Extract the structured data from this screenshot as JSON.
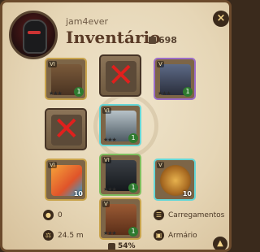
{
  "header": {
    "username": "jam4ever",
    "title": "Inventário",
    "fame_value": "698",
    "close_label": "×"
  },
  "slots": [
    {
      "id": "head",
      "tier": "VI",
      "enchant": "1",
      "empty": false
    },
    {
      "id": "crossed-top",
      "empty": true
    },
    {
      "id": "cape",
      "tier": "V",
      "enchant": "1",
      "empty": false
    },
    {
      "id": "crossed-left",
      "empty": true
    },
    {
      "id": "armor",
      "tier": "VI",
      "enchant": "1",
      "empty": false
    },
    {
      "id": "potion",
      "tier": "VI",
      "quantity": "10",
      "empty": false
    },
    {
      "id": "boots",
      "tier": "VI",
      "enchant": "1",
      "empty": false
    },
    {
      "id": "food",
      "tier": "V",
      "quantity": "10",
      "empty": false
    },
    {
      "id": "mount",
      "tier": "V",
      "enchant": "1",
      "empty": false
    }
  ],
  "stats": {
    "silver": "0",
    "weight": "24.5 m",
    "loadouts_label": "Carregamentos",
    "wardrobe_label": "Armário"
  },
  "footer": {
    "bag_percent": "54%",
    "scroll_up_label": "▲"
  },
  "colors": {
    "gold": "#c9a44c",
    "teal": "#66d7d7",
    "purple": "#9b6cc8",
    "cross_red": "#e0201d"
  }
}
